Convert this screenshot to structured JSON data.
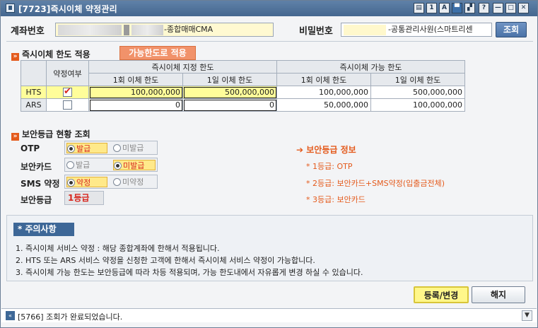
{
  "window": {
    "title": "[7723]즉시이체 약정관리",
    "title_buttons": [
      "▤",
      "1",
      "A",
      "▀",
      "▞",
      "?",
      "—",
      "□",
      "✕"
    ]
  },
  "account": {
    "label": "계좌번호",
    "value_suffix": "-종합매매CMA",
    "password_label": "비밀번호",
    "password_suffix": "-공통관리사원(스마트리센",
    "search_button": "조회"
  },
  "limit_section": {
    "title": "즉시이체 한도 적용",
    "apply_button": "가능한도로 적용",
    "header_agree": "약정여부",
    "header_designated": "즉시이체 지정 한도",
    "header_available": "즉시이체 가능 한도",
    "col_once": "1회 이체 한도",
    "col_daily": "1일 이체 한도",
    "rows": [
      {
        "name": "HTS",
        "agreed": true,
        "designated_once": "100,000,000",
        "designated_daily": "500,000,000",
        "available_once": "100,000,000",
        "available_daily": "500,000,000"
      },
      {
        "name": "ARS",
        "agreed": false,
        "designated_once": "0",
        "designated_daily": "0",
        "available_once": "50,000,000",
        "available_daily": "100,000,000"
      }
    ]
  },
  "security_section": {
    "title": "보안등급 현황 조회",
    "otp": {
      "label": "OTP",
      "options": [
        "발급",
        "미발급"
      ],
      "selected": 0
    },
    "card": {
      "label": "보안카드",
      "options": [
        "발급",
        "미발급"
      ],
      "selected": 1
    },
    "sms": {
      "label": "SMS 약정",
      "options": [
        "약정",
        "미약정"
      ],
      "selected": 0
    },
    "grade": {
      "label": "보안등급",
      "value": "1등급"
    }
  },
  "security_info": {
    "title": "보안등급 정보",
    "items": [
      "* 1등급: OTP",
      "* 2등급: 보안카드+SMS약정(입출금전체)",
      "* 3등급: 보안카드"
    ]
  },
  "notice": {
    "title": "* 주의사항",
    "lines": [
      "1. 즉시이체 서비스 약정 : 해당 종합계좌에 한해서 적용됩니다.",
      "2. HTS 또는 ARS 서비스 약정을 신청한 고객에 한해서 즉시이체 서비스 약정이 가능합니다.",
      "3. 즉시이체 가능 한도는 보안등급에 따라 차등 적용되며, 가능 한도내에서 자유롭게 변경 하실 수 있습니다."
    ]
  },
  "actions": {
    "register": "등록/변경",
    "cancel": "해지"
  },
  "status": {
    "code": "[5766]",
    "message": "조회가 완료되었습니다."
  },
  "colors": {
    "accent_orange": "#e45a1c",
    "highlight_yellow": "#fffd9a",
    "title_blue": "#4b6e97",
    "alert_red": "#d7261e"
  }
}
